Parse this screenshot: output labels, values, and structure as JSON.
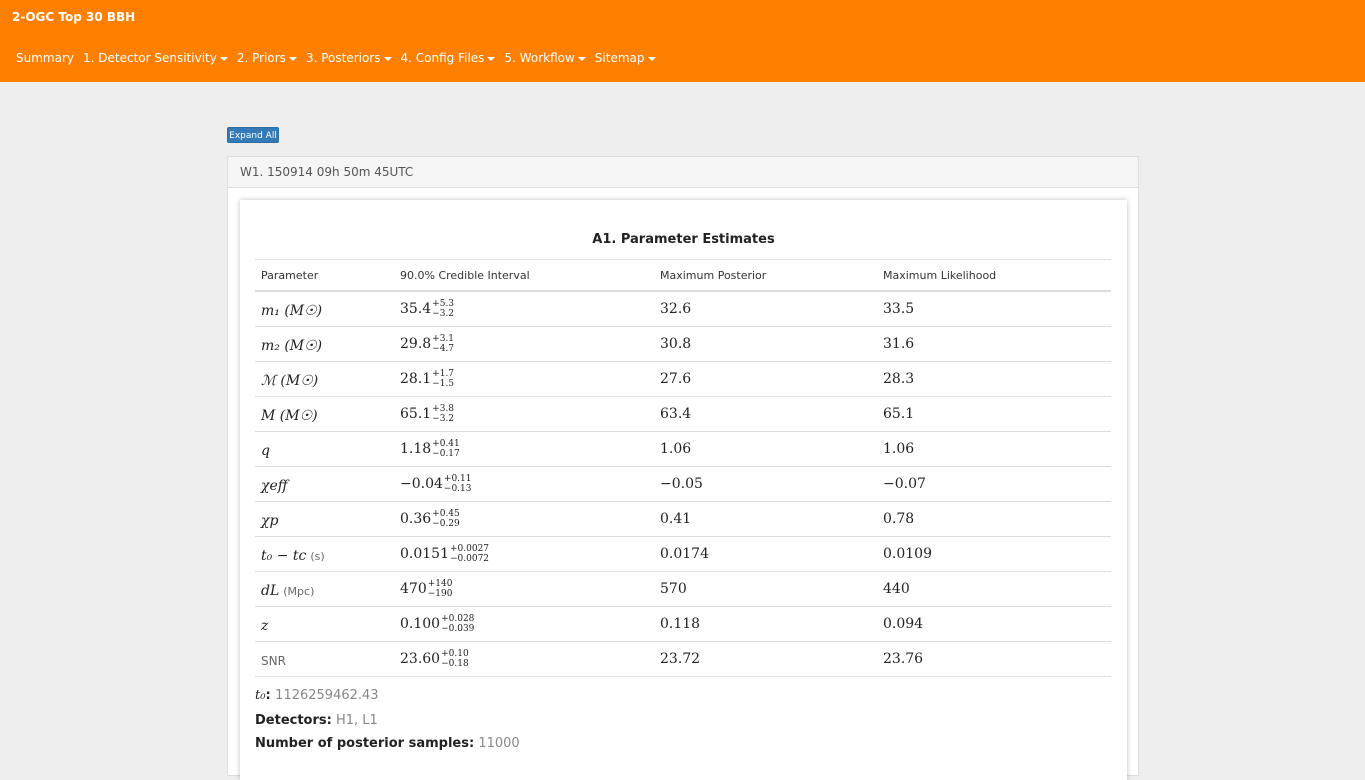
{
  "app": {
    "title": "2-OGC Top 30 BBH"
  },
  "nav": [
    {
      "label": "Summary",
      "dropdown": false
    },
    {
      "label": "1. Detector Sensitivity",
      "dropdown": true
    },
    {
      "label": "2. Priors",
      "dropdown": true
    },
    {
      "label": "3. Posteriors",
      "dropdown": true
    },
    {
      "label": "4. Config Files",
      "dropdown": true
    },
    {
      "label": "5. Workflow",
      "dropdown": true
    },
    {
      "label": "Sitemap",
      "dropdown": true
    }
  ],
  "expand_button": "Expand All",
  "panel": {
    "heading": "W1. 150914 09h 50m 45UTC",
    "table_title": "A1. Parameter Estimates",
    "columns": [
      "Parameter",
      "90.0% Credible Interval",
      "Maximum Posterior",
      "Maximum Likelihood"
    ],
    "rows": [
      {
        "param": "m₁ (M☉)",
        "ci": "35.4",
        "ci_plus": "+5.3",
        "ci_minus": "−3.2",
        "max_post": "32.6",
        "max_like": "33.5"
      },
      {
        "param": "m₂ (M☉)",
        "ci": "29.8",
        "ci_plus": "+3.1",
        "ci_minus": "−4.7",
        "max_post": "30.8",
        "max_like": "31.6"
      },
      {
        "param": "ℳ (M☉)",
        "ci": "28.1",
        "ci_plus": "+1.7",
        "ci_minus": "−1.5",
        "max_post": "27.6",
        "max_like": "28.3"
      },
      {
        "param": "M (M☉)",
        "ci": "65.1",
        "ci_plus": "+3.8",
        "ci_minus": "−3.2",
        "max_post": "63.4",
        "max_like": "65.1"
      },
      {
        "param": "q",
        "ci": "1.18",
        "ci_plus": "+0.41",
        "ci_minus": "−0.17",
        "max_post": "1.06",
        "max_like": "1.06"
      },
      {
        "param": "χeff",
        "ci": "−0.04",
        "ci_plus": "+0.11",
        "ci_minus": "−0.13",
        "max_post": "−0.05",
        "max_like": "−0.07"
      },
      {
        "param": "χp",
        "ci": "0.36",
        "ci_plus": "+0.45",
        "ci_minus": "−0.29",
        "max_post": "0.41",
        "max_like": "0.78"
      },
      {
        "param": "t₀ − tc",
        "unit": "(s)",
        "ci": "0.0151",
        "ci_plus": "+0.0027",
        "ci_minus": "−0.0072",
        "max_post": "0.0174",
        "max_like": "0.0109"
      },
      {
        "param": "dL",
        "unit": "(Mpc)",
        "ci": "470",
        "ci_plus": "+140",
        "ci_minus": "−190",
        "max_post": "570",
        "max_like": "440"
      },
      {
        "param": "z",
        "ci": "0.100",
        "ci_plus": "+0.028",
        "ci_minus": "−0.039",
        "max_post": "0.118",
        "max_like": "0.094"
      },
      {
        "param": "SNR",
        "plain": true,
        "ci": "23.60",
        "ci_plus": "+0.10",
        "ci_minus": "−0.18",
        "max_post": "23.72",
        "max_like": "23.76"
      }
    ],
    "t0_label": "t₀",
    "t0_value": "1126259462.43",
    "detectors_label": "Detectors:",
    "detectors_value": "H1, L1",
    "samples_label": "Number of posterior samples:",
    "samples_value": "11000"
  }
}
